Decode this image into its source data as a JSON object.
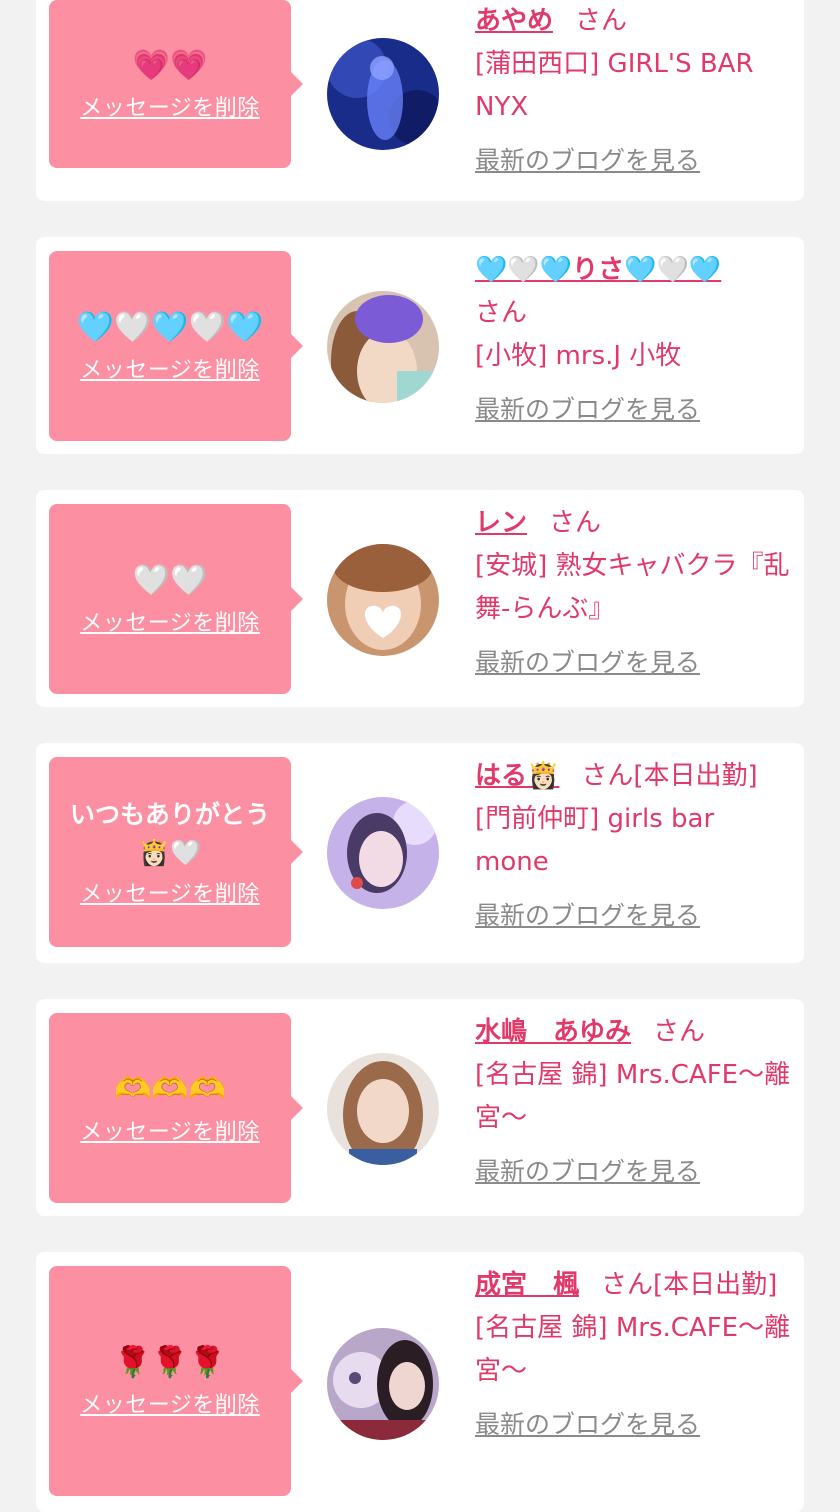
{
  "delete_label": "メッセージを削除",
  "blog_label": "最新のブログを見る",
  "colors": {
    "bubble": "#fc8fa1",
    "accent": "#e0396a",
    "muted": "#8a8a8a",
    "background": "#f2f2f2"
  },
  "cards": [
    {
      "stamp": "💗💗",
      "name": "あやめ",
      "suffix": "さん",
      "shop": "[蒲田西口] GIRL'S BAR NYX",
      "avatar": "avatar-photo-blue"
    },
    {
      "stamp": "🩵🤍🩵🤍🩵",
      "name": "🩵🤍🩵りさ🩵🤍🩵",
      "suffix": "さん",
      "shop": "[小牧] mrs.J 小牧",
      "avatar": "avatar-photo-purple-hair"
    },
    {
      "stamp": "🤍🤍",
      "name": "レン",
      "suffix": "さん",
      "shop": "[安城] 熟女キャバクラ『乱舞-らんぶ』",
      "avatar": "avatar-photo-heart-cover"
    },
    {
      "stamp": "いつもありがとう👸🏻🤍",
      "name": "はる👸🏻",
      "suffix": "さん[本日出勤]",
      "shop": "[門前仲町] girls bar mone",
      "avatar": "avatar-photo-lavender"
    },
    {
      "stamp": "🫶🫶🫶",
      "name": "水嶋　あゆみ",
      "suffix": "さん",
      "shop": "[名古屋 錦] Mrs.CAFE〜離宮〜",
      "avatar": "avatar-photo-portrait"
    },
    {
      "stamp": "🌹🌹🌹",
      "name": "成宮　楓",
      "suffix": "さん[本日出勤]",
      "shop": "[名古屋 錦] Mrs.CAFE〜離宮〜",
      "avatar": "avatar-photo-doll"
    }
  ]
}
